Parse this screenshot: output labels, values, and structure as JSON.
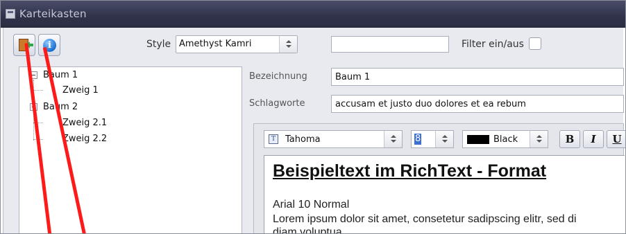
{
  "window": {
    "title": "Karteikasten"
  },
  "toolbar": {
    "exit_button": {
      "icon": "exit-door-icon"
    },
    "info_button": {
      "icon": "info-icon",
      "glyph": "i"
    },
    "style_label": "Style",
    "style_value": "Amethyst Kamri",
    "filter_value": "",
    "filter_label": "Filter ein/aus",
    "filter_checked": false
  },
  "tree": {
    "nodes": [
      {
        "label": "Baum 1",
        "level": 0,
        "expanded": true
      },
      {
        "label": "Zweig 1",
        "level": 1
      },
      {
        "label": "Baum 2",
        "level": 0,
        "expanded": true
      },
      {
        "label": "Zweig 2.1",
        "level": 1
      },
      {
        "label": "Zweig 2.2",
        "level": 1
      }
    ]
  },
  "form": {
    "bezeichnung_label": "Bezeichnung",
    "bezeichnung_value": "Baum 1",
    "schlagworte_label": "Schlagworte",
    "schlagworte_value": "accusam et justo duo dolores et ea rebum"
  },
  "editor": {
    "font_name": "Tahoma",
    "font_size": "8",
    "color_name": "Black",
    "color_hex": "#000000",
    "bold_label": "B",
    "italic_label": "I",
    "underline_label": "U",
    "heading": "Beispieltext im RichText - Format",
    "subheading": "Arial 10 Normal",
    "body_line1": "Lorem ipsum dolor sit amet, consetetur sadipscing elitr, sed di",
    "body_line2": "diam voluptua."
  },
  "annotation_color": "#ff1a1a"
}
